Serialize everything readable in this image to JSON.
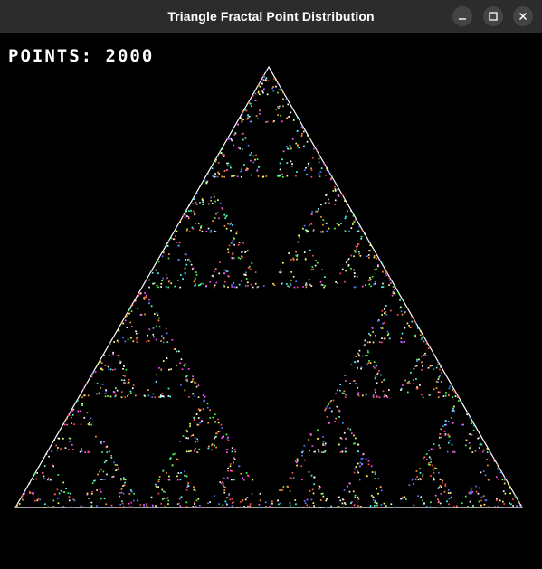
{
  "window": {
    "title": "Triangle Fractal Point Distribution"
  },
  "titlebar_buttons": [
    {
      "name": "minimize-button",
      "icon": "minimize-icon"
    },
    {
      "name": "maximize-button",
      "icon": "maximize-icon"
    },
    {
      "name": "close-button",
      "icon": "close-icon"
    }
  ],
  "counter": {
    "label": "POINTS:",
    "value": "2000",
    "text": "POINTS: 2000"
  },
  "fractal": {
    "type": "sierpinski-chaos-game",
    "point_count": 2000,
    "outline_color": "#ffffff",
    "background_color": "#000000",
    "point_colors": [
      "#ff4d4d",
      "#4dff4d",
      "#4d7dff",
      "#ff4dff",
      "#4dffff",
      "#ffff66",
      "#ffffff",
      "#ff9933"
    ]
  },
  "colors": {
    "titlebar": "#2c2c2c",
    "title_text": "#ffffff",
    "button_bg": "#444444"
  }
}
